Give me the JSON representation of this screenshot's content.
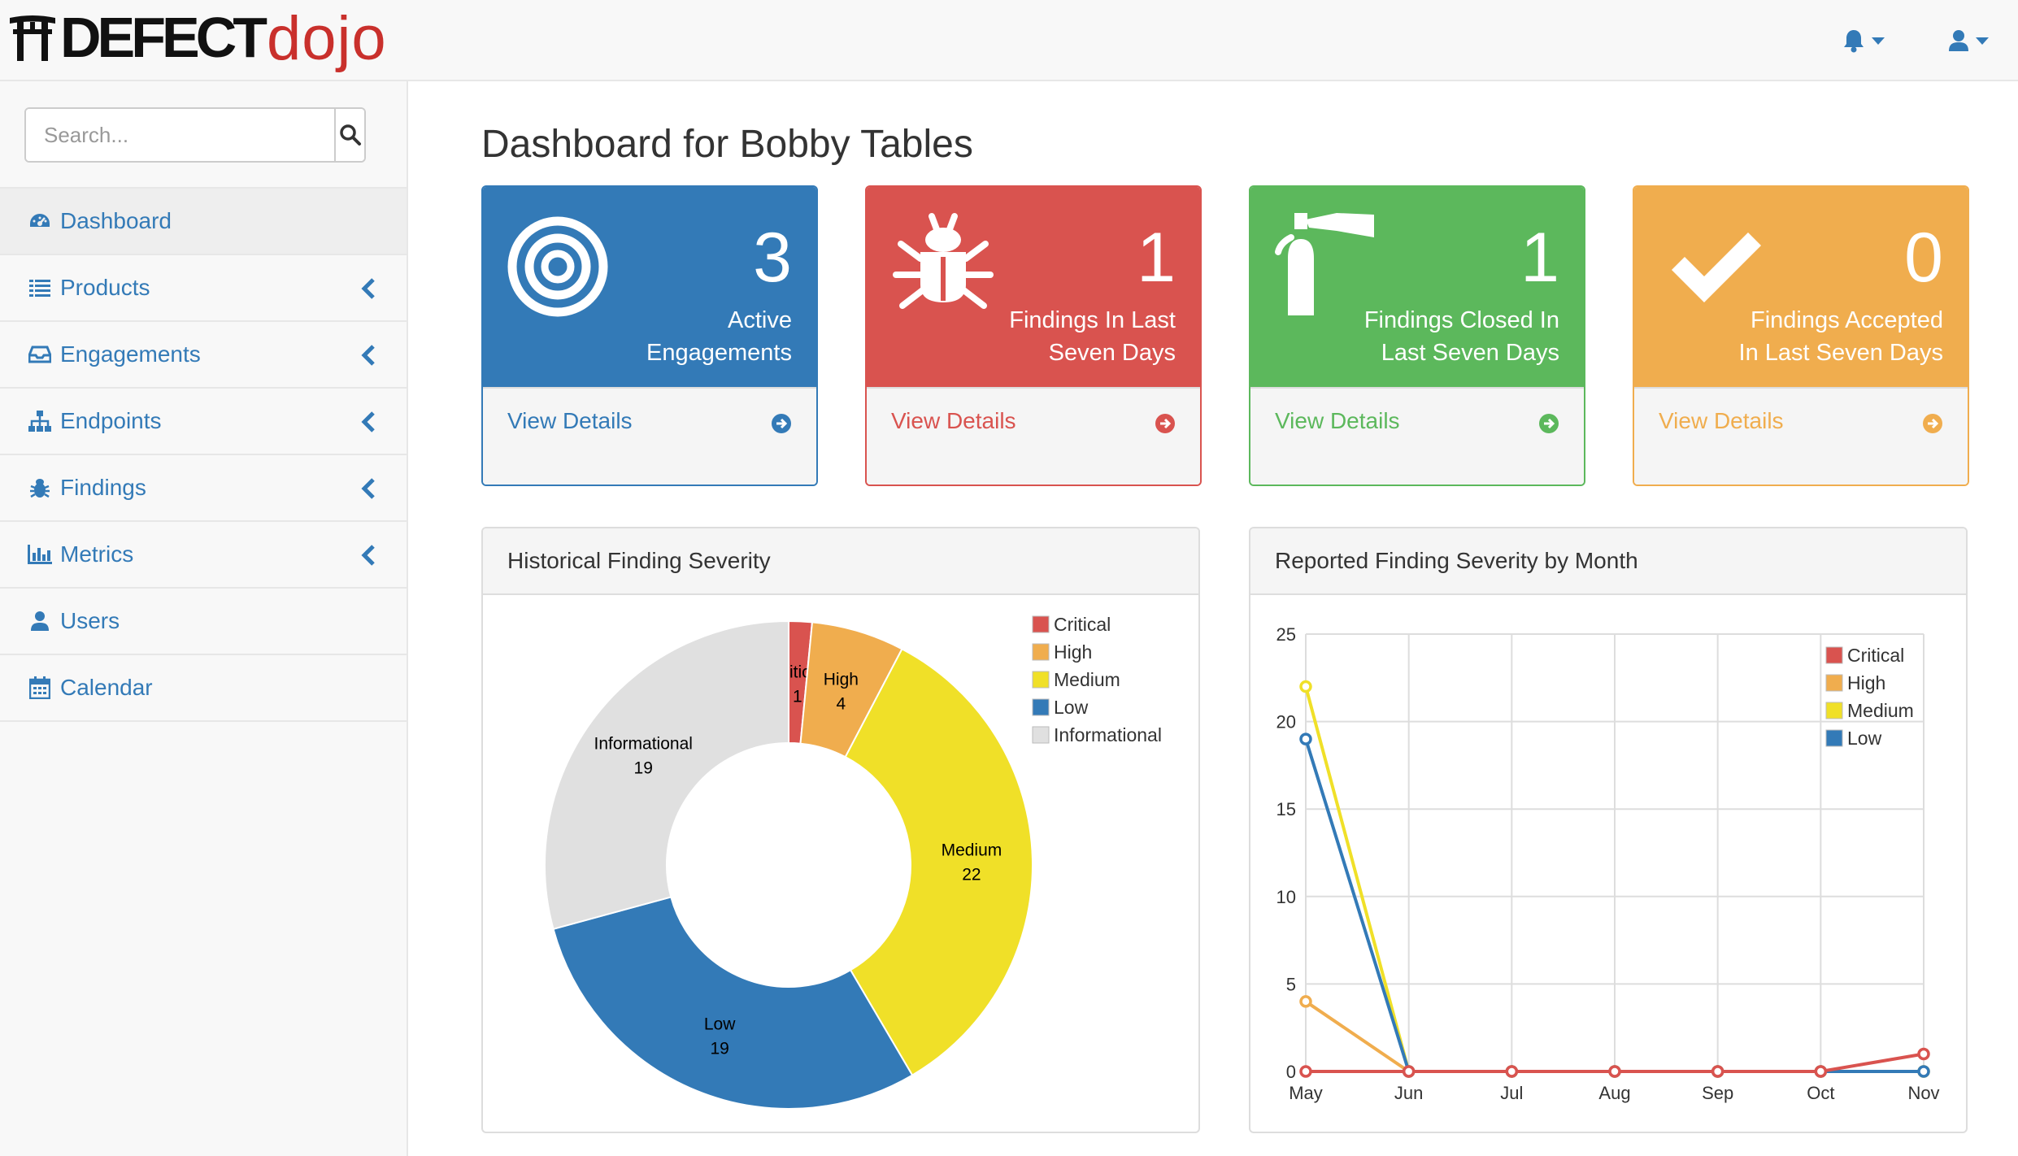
{
  "brand": {
    "part1": "DEFECT",
    "part2": "dojo"
  },
  "navbar": {
    "notifications_icon": "bell-icon",
    "user_icon": "user-icon"
  },
  "sidebar": {
    "search_placeholder": "Search...",
    "items": [
      {
        "label": "Dashboard",
        "icon": "dashboard-icon",
        "active": true
      },
      {
        "label": "Products",
        "icon": "list-icon"
      },
      {
        "label": "Engagements",
        "icon": "inbox-icon"
      },
      {
        "label": "Endpoints",
        "icon": "sitemap-icon"
      },
      {
        "label": "Findings",
        "icon": "bug-icon"
      },
      {
        "label": "Metrics",
        "icon": "bar-chart-icon"
      },
      {
        "label": "Users",
        "icon": "user-icon"
      },
      {
        "label": "Calendar",
        "icon": "calendar-icon"
      }
    ]
  },
  "page": {
    "title": "Dashboard for Bobby Tables"
  },
  "panels": [
    {
      "count": "3",
      "label": "Active\nEngagements",
      "link": "View Details",
      "color": "#337ab7",
      "icon": "bullseye-icon"
    },
    {
      "count": "1",
      "label": "Findings In Last\nSeven Days",
      "link": "View Details",
      "color": "#d9534f",
      "icon": "bug-icon"
    },
    {
      "count": "1",
      "label": "Findings Closed In\nLast Seven Days",
      "link": "View Details",
      "color": "#5cb85c",
      "icon": "fire-extinguisher-icon"
    },
    {
      "count": "0",
      "label": "Findings Accepted\nIn Last Seven Days",
      "link": "View Details",
      "color": "#f0ad4e",
      "icon": "check-icon"
    }
  ],
  "charts": {
    "donut_title": "Historical Finding Severity",
    "line_title": "Reported Finding Severity by Month"
  },
  "chart_data": [
    {
      "type": "pie",
      "title": "Historical Finding Severity",
      "categories": [
        "Critical",
        "High",
        "Medium",
        "Low",
        "Informational"
      ],
      "values": [
        1,
        4,
        22,
        19,
        19
      ],
      "colors": [
        "#d9534f",
        "#f0ad4e",
        "#f0e028",
        "#337ab7",
        "#e0e0e0"
      ],
      "legend": "top-right"
    },
    {
      "type": "line",
      "title": "Reported Finding Severity by Month",
      "x": [
        "May",
        "Jun",
        "Jul",
        "Aug",
        "Sep",
        "Oct",
        "Nov"
      ],
      "ylim": [
        0,
        25
      ],
      "yticks": [
        0,
        5,
        10,
        15,
        20,
        25
      ],
      "grid": true,
      "legend": "top-right",
      "series": [
        {
          "name": "Critical",
          "color": "#d9534f",
          "values": [
            0,
            0,
            0,
            0,
            0,
            0,
            1
          ]
        },
        {
          "name": "High",
          "color": "#f0ad4e",
          "values": [
            4,
            0,
            0,
            0,
            0,
            0,
            0
          ]
        },
        {
          "name": "Medium",
          "color": "#f0e028",
          "values": [
            22,
            0,
            0,
            0,
            0,
            0,
            0
          ]
        },
        {
          "name": "Low",
          "color": "#337ab7",
          "values": [
            19,
            0,
            0,
            0,
            0,
            0,
            0
          ]
        }
      ]
    }
  ]
}
